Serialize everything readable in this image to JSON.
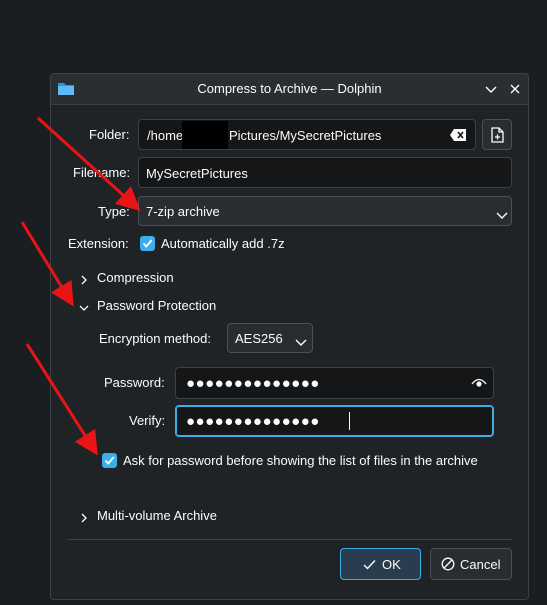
{
  "window": {
    "title": "Compress to Archive — Dolphin"
  },
  "form": {
    "folder_label": "Folder:",
    "folder_prefix": "/home",
    "folder_suffix": "Pictures/MySecretPictures",
    "filename_label": "Filename:",
    "filename_value": "MySecretPictures",
    "type_label": "Type:",
    "type_value": "7-zip archive",
    "extension_label": "Extension:",
    "extension_checkbox_label": "Automatically add .7z"
  },
  "sections": {
    "compression": "Compression",
    "password_protection": "Password Protection",
    "multi_volume": "Multi-volume Archive"
  },
  "password": {
    "encryption_label": "Encryption method:",
    "encryption_value": "AES256",
    "password_label": "Password:",
    "password_mask": "●●●●●●●●●●●●●●",
    "verify_label": "Verify:",
    "verify_mask": "●●●●●●●●●●●●●●",
    "ask_checkbox_label": "Ask for password before showing the list of files in the archive"
  },
  "buttons": {
    "ok": "OK",
    "cancel": "Cancel"
  },
  "colors": {
    "accent": "#3daee9",
    "annotation_arrow": "#e81416"
  }
}
